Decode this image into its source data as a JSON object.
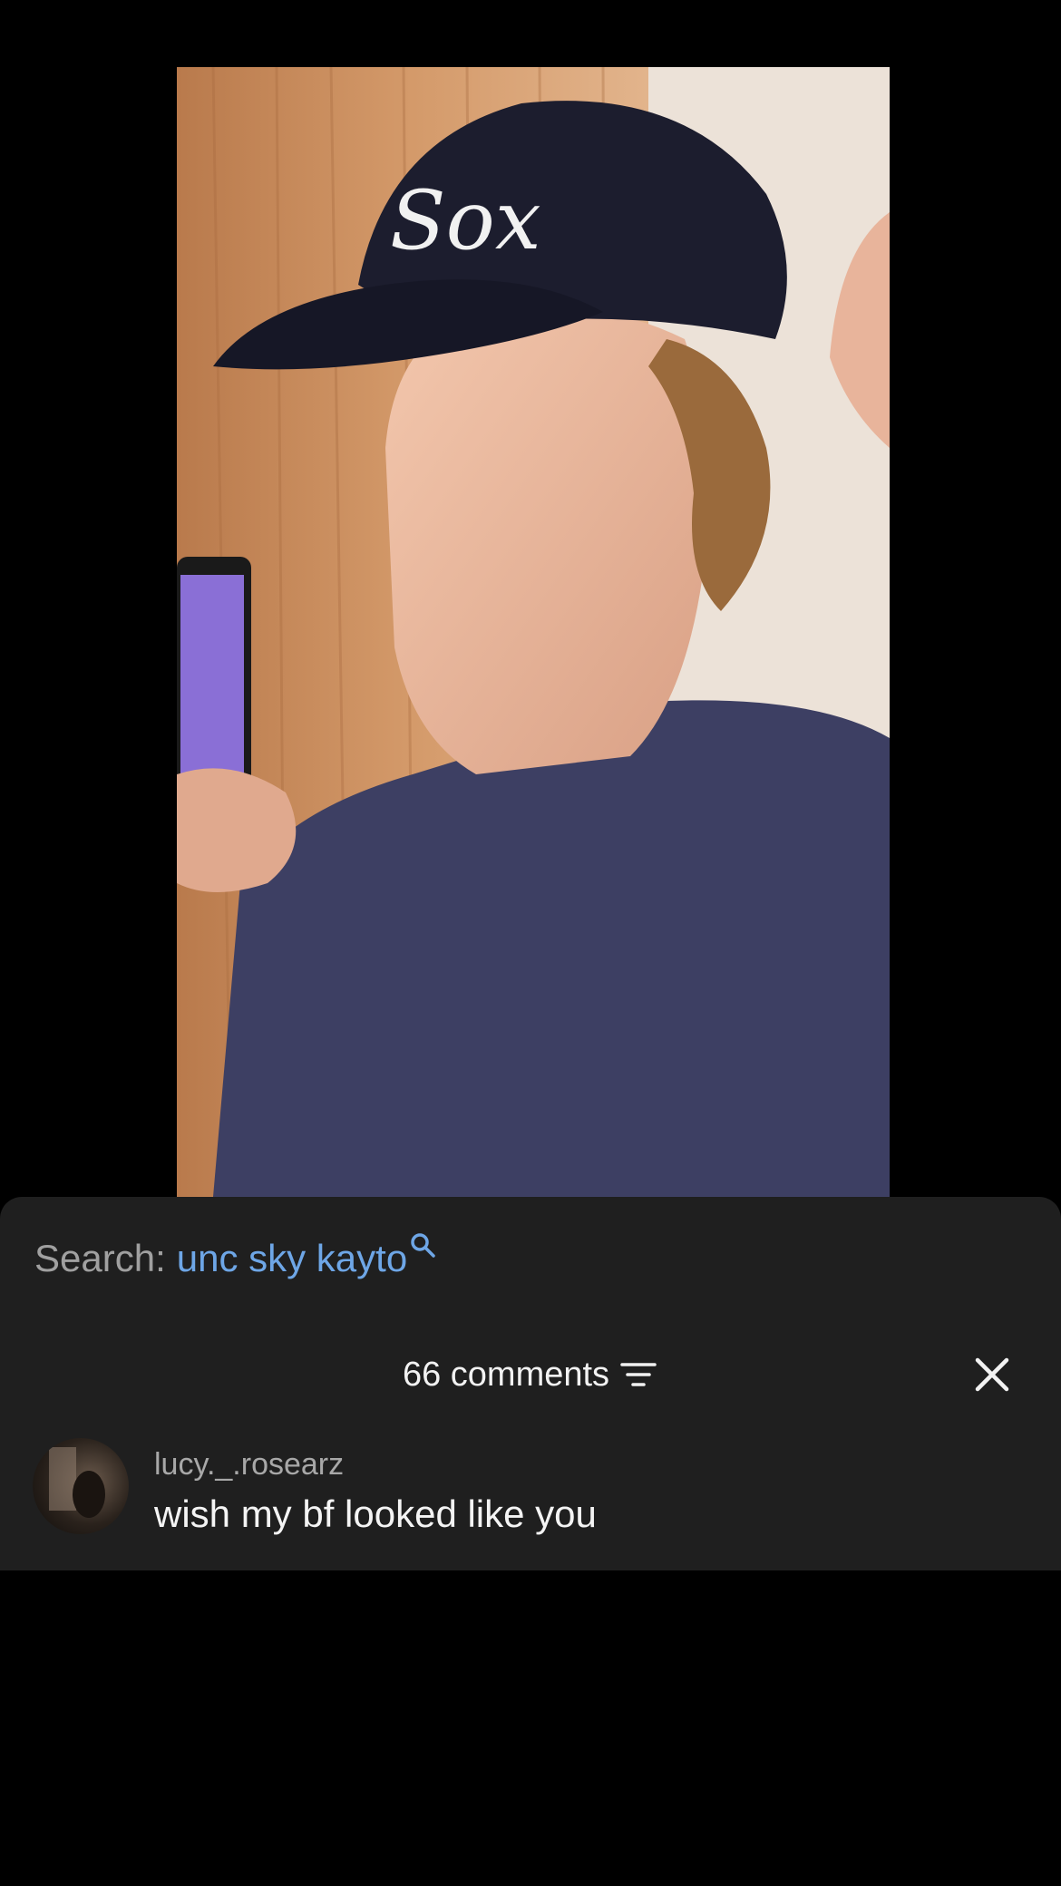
{
  "search": {
    "prefix": "Search:",
    "query": "unc sky kayto",
    "icon": "search-icon"
  },
  "comments_header": {
    "count_label": "66 comments",
    "filter_icon": "filter-icon",
    "close_icon": "close-icon"
  },
  "comments": [
    {
      "author": "lucy._.rosearz",
      "text": "wish my bf looked like you"
    }
  ],
  "colors": {
    "sheet_background": "#1f1f1f",
    "search_query": "#6ea6e6",
    "search_prefix": "#a0a0a0",
    "username": "#a8a8a8",
    "text_primary": "#f4f4f4",
    "page_background": "#000000"
  }
}
